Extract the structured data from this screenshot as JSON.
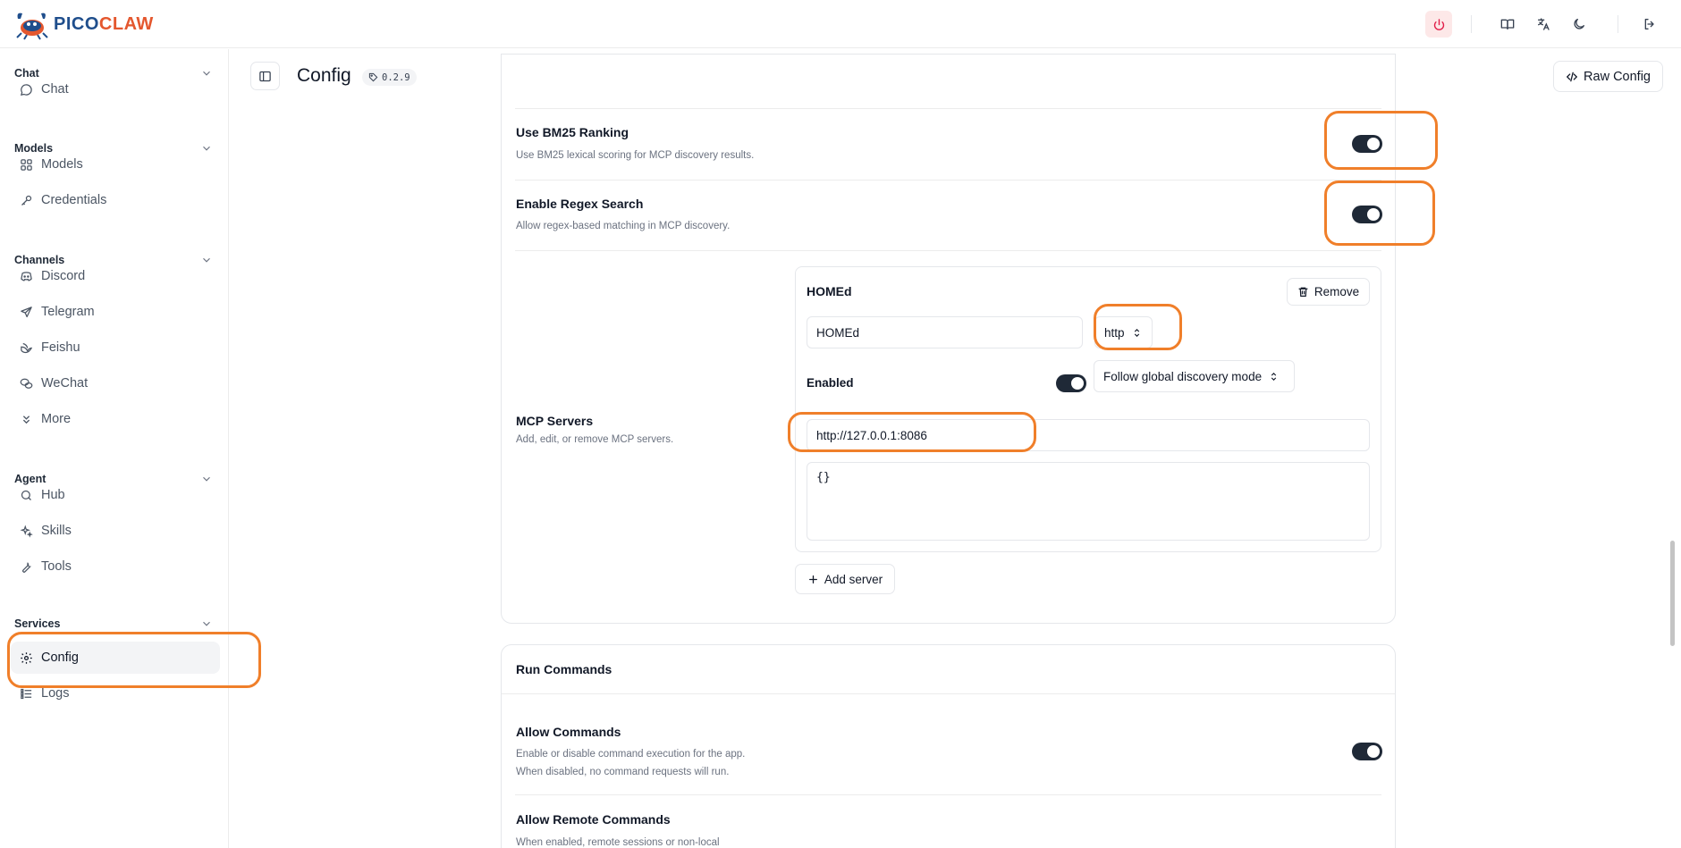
{
  "brand": {
    "part1": "PICO",
    "part2": "CLAW"
  },
  "sidebar": {
    "groups": [
      {
        "title": "Chat",
        "items": [
          {
            "label": "Chat",
            "icon": "chat-bubble-icon"
          }
        ]
      },
      {
        "title": "Models",
        "items": [
          {
            "label": "Models",
            "icon": "grid-icon"
          },
          {
            "label": "Credentials",
            "icon": "key-icon"
          }
        ]
      },
      {
        "title": "Channels",
        "items": [
          {
            "label": "Discord",
            "icon": "discord-icon"
          },
          {
            "label": "Telegram",
            "icon": "send-icon"
          },
          {
            "label": "Feishu",
            "icon": "feishu-icon"
          },
          {
            "label": "WeChat",
            "icon": "wechat-icon"
          },
          {
            "label": "More",
            "icon": "chevrons-down-icon"
          }
        ]
      },
      {
        "title": "Agent",
        "items": [
          {
            "label": "Hub",
            "icon": "search-icon"
          },
          {
            "label": "Skills",
            "icon": "sparkles-icon"
          },
          {
            "label": "Tools",
            "icon": "wrench-icon"
          }
        ]
      },
      {
        "title": "Services",
        "items": [
          {
            "label": "Config",
            "icon": "gear-icon",
            "active": true
          },
          {
            "label": "Logs",
            "icon": "logs-icon"
          }
        ]
      }
    ]
  },
  "header": {
    "title": "Config",
    "version": "0.2.9",
    "raw_config_label": "Raw Config"
  },
  "settings": {
    "bm25": {
      "label": "Use BM25 Ranking",
      "desc": "Use BM25 lexical scoring for MCP discovery results.",
      "enabled": true
    },
    "regex": {
      "label": "Enable Regex Search",
      "desc": "Allow regex-based matching in MCP discovery.",
      "enabled": true
    },
    "mcp": {
      "label": "MCP Servers",
      "desc": "Add, edit, or remove MCP servers.",
      "server": {
        "title": "HOMEd",
        "remove_label": "Remove",
        "name_value": "HOMEd",
        "transport": "http",
        "enabled_label": "Enabled",
        "enabled": true,
        "discovery_mode": "Follow global discovery mode",
        "url_value": "http://127.0.0.1:8086",
        "headers_value": "{}"
      },
      "add_label": "Add server"
    }
  },
  "run_commands": {
    "title": "Run Commands",
    "allow": {
      "label": "Allow Commands",
      "desc1": "Enable or disable command execution for the app.",
      "desc2": "When disabled, no command requests will run.",
      "enabled": true
    },
    "remote": {
      "label": "Allow Remote Commands",
      "desc": "When enabled, remote sessions or non-local"
    }
  },
  "colors": {
    "accent_dark": "#1f2937",
    "annotation": "#f07f2a",
    "power": "#e11d48"
  }
}
